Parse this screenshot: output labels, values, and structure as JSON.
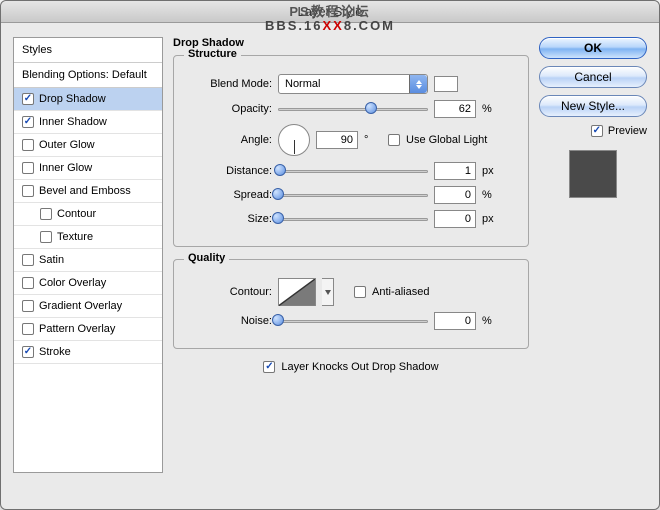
{
  "title": "Layer Style",
  "watermark": {
    "line1": "PS教程论坛",
    "line2_pre": "BBS.16",
    "line2_mid": "XX",
    "line2_post": "8.COM"
  },
  "styles": {
    "header": "Styles",
    "blending_options": "Blending Options: Default",
    "items": [
      {
        "label": "Drop Shadow",
        "checked": true,
        "selected": true
      },
      {
        "label": "Inner Shadow",
        "checked": true
      },
      {
        "label": "Outer Glow",
        "checked": false
      },
      {
        "label": "Inner Glow",
        "checked": false
      },
      {
        "label": "Bevel and Emboss",
        "checked": false
      },
      {
        "label": "Contour",
        "checked": false,
        "indent": true
      },
      {
        "label": "Texture",
        "checked": false,
        "indent": true
      },
      {
        "label": "Satin",
        "checked": false
      },
      {
        "label": "Color Overlay",
        "checked": false
      },
      {
        "label": "Gradient Overlay",
        "checked": false
      },
      {
        "label": "Pattern Overlay",
        "checked": false
      },
      {
        "label": "Stroke",
        "checked": true
      }
    ]
  },
  "drop_shadow": {
    "panel_title": "Drop Shadow",
    "structure": {
      "group_title": "Structure",
      "blend_mode_label": "Blend Mode:",
      "blend_mode_value": "Normal",
      "opacity_label": "Opacity:",
      "opacity_value": "62",
      "opacity_unit": "%",
      "angle_label": "Angle:",
      "angle_value": "90",
      "angle_unit": "°",
      "use_global_label": "Use Global Light",
      "use_global_checked": false,
      "distance_label": "Distance:",
      "distance_value": "1",
      "distance_unit": "px",
      "spread_label": "Spread:",
      "spread_value": "0",
      "spread_unit": "%",
      "size_label": "Size:",
      "size_value": "0",
      "size_unit": "px"
    },
    "quality": {
      "group_title": "Quality",
      "contour_label": "Contour:",
      "anti_aliased_label": "Anti-aliased",
      "anti_aliased_checked": false,
      "noise_label": "Noise:",
      "noise_value": "0",
      "noise_unit": "%"
    },
    "knockout_label": "Layer Knocks Out Drop Shadow",
    "knockout_checked": true
  },
  "buttons": {
    "ok": "OK",
    "cancel": "Cancel",
    "new_style": "New Style...",
    "preview_label": "Preview",
    "preview_checked": true
  }
}
